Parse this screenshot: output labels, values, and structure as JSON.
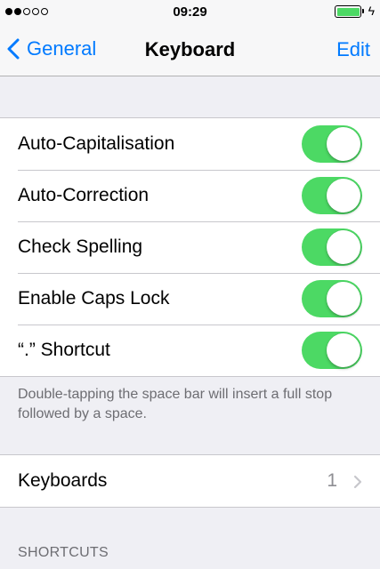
{
  "status_bar": {
    "time": "09:29",
    "signal_bars_filled": 2,
    "signal_bars_total": 5,
    "battery_level": 1.0,
    "icons": [
      "signal-dots-icon",
      "battery-icon",
      "charging-bolt-icon"
    ]
  },
  "nav": {
    "back_label": "General",
    "title": "Keyboard",
    "edit_label": "Edit"
  },
  "settings": {
    "items": [
      {
        "label": "Auto-Capitalisation",
        "on": true
      },
      {
        "label": "Auto-Correction",
        "on": true
      },
      {
        "label": "Check Spelling",
        "on": true
      },
      {
        "label": "Enable Caps Lock",
        "on": true
      },
      {
        "label": "“.” Shortcut",
        "on": true
      }
    ],
    "footer": "Double-tapping the space bar will insert a full stop followed by a space."
  },
  "keyboards": {
    "label": "Keyboards",
    "count": "1"
  },
  "shortcuts": {
    "header": "SHORTCUTS"
  },
  "colors": {
    "accent": "#007aff",
    "switch_on": "#4cd964",
    "background": "#efeff4",
    "secondary_text": "#6d6d72"
  }
}
